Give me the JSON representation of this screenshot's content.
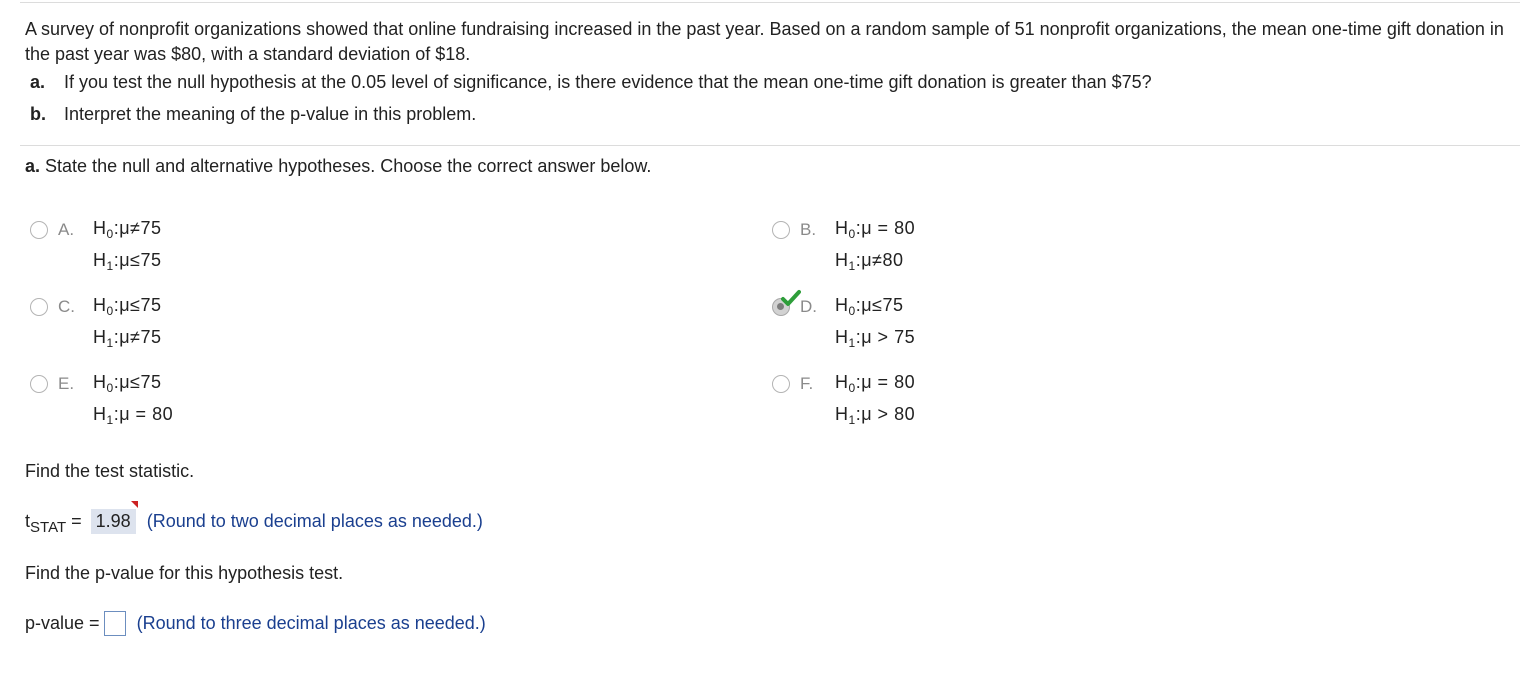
{
  "problem": {
    "text": "A survey of nonprofit organizations showed that online fundraising increased in the past year. Based on a random sample of 51 nonprofit organizations, the mean one-time gift donation in the past year was $80, with a standard deviation of $18.",
    "parts": [
      {
        "letter": "a.",
        "text": "If you test the null hypothesis at the 0.05 level of significance, is there evidence that the mean one-time gift donation is greater than $75?"
      },
      {
        "letter": "b.",
        "text": "Interpret the meaning of the p-value in this problem."
      }
    ]
  },
  "question_a": {
    "label": "a.",
    "instruction": "State the null and alternative hypotheses. Choose the correct answer below."
  },
  "options": [
    {
      "letter": "A.",
      "h0": ":μ≠75",
      "h1": ":μ≤75",
      "selected": false
    },
    {
      "letter": "B.",
      "h0": ":μ = 80",
      "h1": ":μ≠80",
      "selected": false
    },
    {
      "letter": "C.",
      "h0": ":μ≤75",
      "h1": ":μ≠75",
      "selected": false
    },
    {
      "letter": "D.",
      "h0": ":μ≤75",
      "h1": ":μ > 75",
      "selected": true
    },
    {
      "letter": "E.",
      "h0": ":μ≤75",
      "h1": ":μ = 80",
      "selected": false
    },
    {
      "letter": "F.",
      "h0": ":μ = 80",
      "h1": ":μ > 80",
      "selected": false
    }
  ],
  "hyp_labels": {
    "h": "H",
    "sub0": "0",
    "sub1": "1"
  },
  "test_statistic": {
    "prompt": "Find the test statistic.",
    "label_t": "t",
    "label_sub": "STAT",
    "equals": " =",
    "value": "1.98",
    "hint": "(Round to two decimal places as needed.)"
  },
  "p_value": {
    "prompt": "Find the p-value for this hypothesis test.",
    "label": "p-value =",
    "value": "",
    "hint": "(Round to three decimal places as needed.)"
  },
  "colors": {
    "hint": "#1a3f8f",
    "check": "#2e9e3a",
    "flag": "#cc2222",
    "input_border": "#6c8ebf"
  }
}
